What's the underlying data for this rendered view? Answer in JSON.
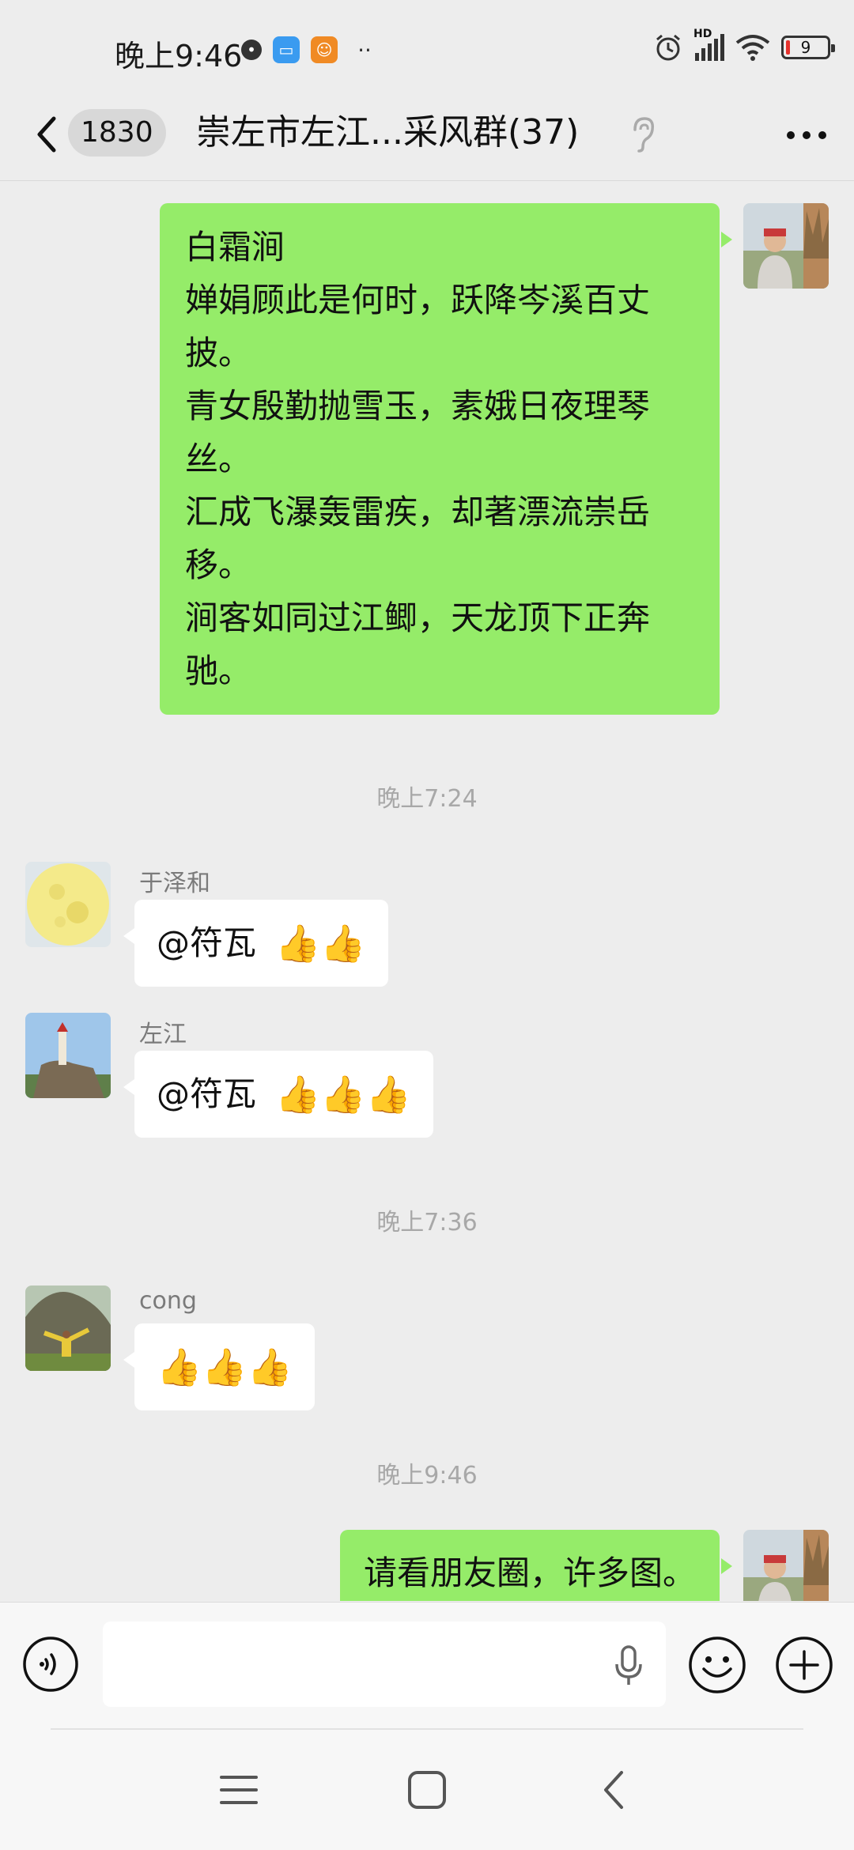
{
  "status_bar": {
    "time": "晚上9:46",
    "network": "HD",
    "battery": "9",
    "more_icons": "··"
  },
  "header": {
    "unread_count": "1830",
    "title": "崇左市左江...采风群(37)"
  },
  "messages": {
    "poem": {
      "lines": [
        "白霜涧",
        "婵娟顾此是何时，跃降岑溪百丈",
        "披。",
        "青女殷勤抛雪玉，素娥日夜理琴",
        "丝。",
        "汇成飞瀑轰雷疾，却著漂流崇岳",
        "移。",
        "涧客如同过江鲫，天龙顶下正奔",
        "驰。"
      ]
    },
    "timestamps": [
      "晚上7:24",
      "晚上7:36",
      "晚上9:46"
    ],
    "m1": {
      "sender": "于泽和",
      "text": "@符瓦",
      "thumbs": "👍👍"
    },
    "m2": {
      "sender": "左江",
      "text": "@符瓦",
      "thumbs": "👍👍👍"
    },
    "m3": {
      "sender": "cong",
      "thumbs": "👍👍👍"
    },
    "m4": {
      "text": "请看朋友圈，许多图。"
    }
  },
  "input": {
    "value": ""
  },
  "colors": {
    "background": "#ededed",
    "self_bubble": "#95ec69",
    "other_bubble": "#ffffff",
    "timestamp_text": "#a8a8a8"
  }
}
